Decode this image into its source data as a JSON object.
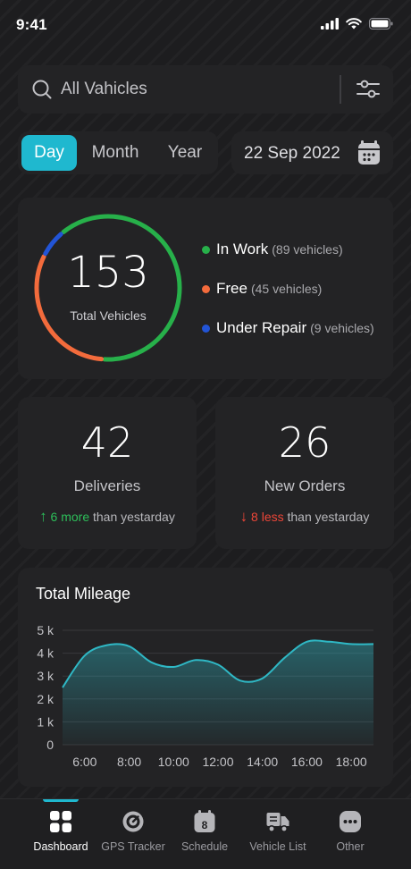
{
  "status": {
    "time": "9:41"
  },
  "search": {
    "placeholder": "All Vahicles"
  },
  "periods": {
    "day": "Day",
    "month": "Month",
    "year": "Year",
    "selected": "Day"
  },
  "date": "22 Sep 2022",
  "vehicles": {
    "total": "153",
    "total_label": "Total Vehicles",
    "segments": [
      {
        "name": "In Work",
        "count_text": "(89 vehicles)",
        "count": 89,
        "color": "#27b04a"
      },
      {
        "name": "Free",
        "count_text": "(45 vehicles)",
        "count": 45,
        "color": "#f36b3c"
      },
      {
        "name": "Under Repair",
        "count_text": "(9 vehicles)",
        "count": 9,
        "color": "#2254d6"
      }
    ]
  },
  "stats": {
    "deliveries": {
      "value": "42",
      "label": "Deliveries",
      "change": "6 more",
      "suffix": "than yestarday",
      "direction": "up",
      "color": "#2dbf5a"
    },
    "orders": {
      "value": "26",
      "label": "New Orders",
      "change": "8 less",
      "suffix": "than yestarday",
      "direction": "down",
      "color": "#ee4638"
    }
  },
  "mileage": {
    "title": "Total Mileage"
  },
  "chart_data": {
    "type": "area",
    "title": "Total Mileage",
    "x": [
      "5:00",
      "6:00",
      "7:00",
      "8:00",
      "9:00",
      "10:00",
      "11:00",
      "12:00",
      "13:00",
      "14:00",
      "15:00",
      "16:00",
      "17:00",
      "18:00",
      "19:00"
    ],
    "x_tick_labels": [
      "6:00",
      "8:00",
      "10:00",
      "12:00",
      "14:00",
      "16:00",
      "18:00"
    ],
    "series": [
      {
        "values": [
          2.5,
          3.9,
          4.35,
          4.3,
          3.6,
          3.4,
          3.7,
          3.5,
          2.8,
          2.9,
          3.8,
          4.5,
          4.5,
          4.4,
          4.4
        ]
      }
    ],
    "y_tick_labels": [
      "0",
      "1 k",
      "2 k",
      "3 k",
      "4 k",
      "5 k"
    ],
    "ylim": [
      0,
      5
    ],
    "unit": "k",
    "color": "#2fb8c5",
    "grid": true
  },
  "nav": [
    {
      "label": "Dashboard",
      "icon": "dashboard-icon",
      "active": true
    },
    {
      "label": "GPS Tracker",
      "icon": "gps-tracker-icon"
    },
    {
      "label": "Schedule",
      "icon": "schedule-icon",
      "badge": "8"
    },
    {
      "label": "Vehicle List",
      "icon": "vehicle-list-icon"
    },
    {
      "label": "Other",
      "icon": "other-icon"
    }
  ]
}
